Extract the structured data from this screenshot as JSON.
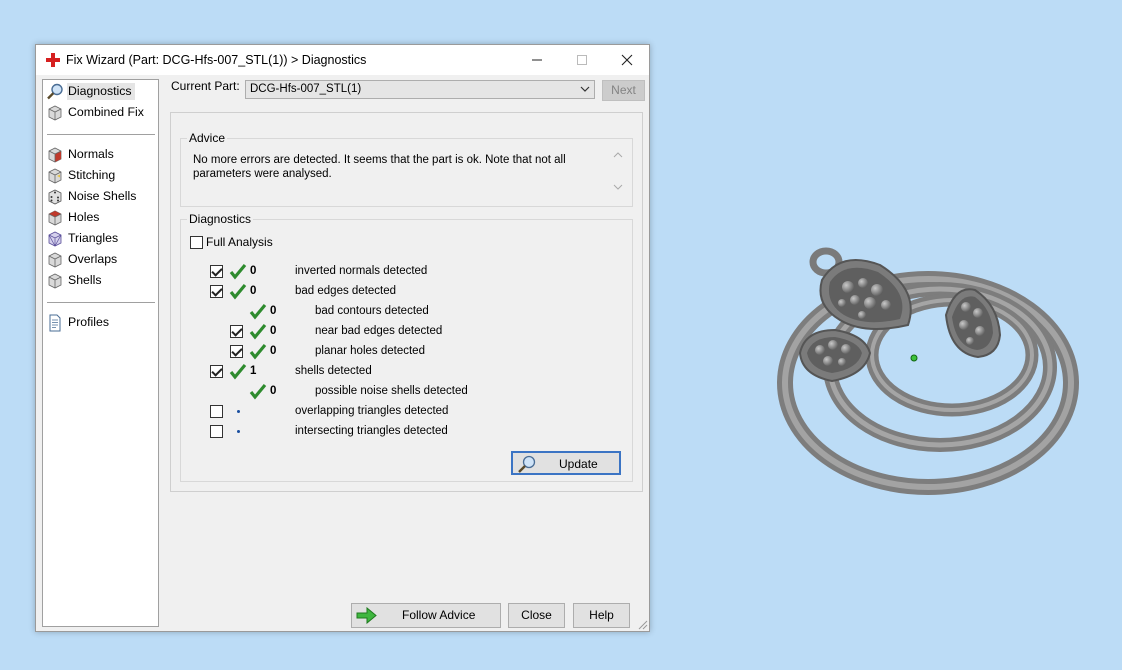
{
  "window": {
    "title": "Fix Wizard (Part: DCG-Hfs-007_STL(1)) > Diagnostics",
    "minimize_icon": "minimize-icon",
    "maximize_icon": "maximize-icon",
    "close_icon": "close-icon"
  },
  "sidebar": {
    "items": [
      {
        "label": "Diagnostics",
        "icon": "magnifier-icon",
        "selected": true
      },
      {
        "label": "Combined Fix",
        "icon": "cube-icon"
      },
      {
        "label": "Normals",
        "icon": "cube-red-face-icon"
      },
      {
        "label": "Stitching",
        "icon": "cube-stitch-icon"
      },
      {
        "label": "Noise Shells",
        "icon": "dice-icon"
      },
      {
        "label": "Holes",
        "icon": "cube-red-face-icon"
      },
      {
        "label": "Triangles",
        "icon": "cube-triangle-icon"
      },
      {
        "label": "Overlaps",
        "icon": "cube-icon"
      },
      {
        "label": "Shells",
        "icon": "cube-icon"
      },
      {
        "label": "Profiles",
        "icon": "document-icon"
      }
    ]
  },
  "current_part": {
    "label": "Current Part:",
    "value": "DCG-Hfs-007_STL(1)",
    "next_label": "Next"
  },
  "advice": {
    "title": "Advice",
    "text": "No more errors are detected. It seems that the part is ok. Note that not all parameters were analysed."
  },
  "diagnostics": {
    "title": "Diagnostics",
    "full_analysis_label": "Full Analysis",
    "rows": [
      {
        "checkbox": true,
        "checked": true,
        "status": "ok",
        "count": "0",
        "label": "inverted normals detected"
      },
      {
        "checkbox": true,
        "checked": true,
        "status": "ok",
        "count": "0",
        "label": "bad edges detected"
      },
      {
        "checkbox": false,
        "status": "ok",
        "count": "0",
        "label": "bad contours detected"
      },
      {
        "checkbox": true,
        "checked": true,
        "status": "ok",
        "count": "0",
        "label": "near bad edges detected"
      },
      {
        "checkbox": true,
        "checked": true,
        "status": "ok",
        "count": "0",
        "label": "planar holes detected"
      },
      {
        "checkbox": true,
        "checked": true,
        "status": "ok",
        "count": "1",
        "label": "shells detected"
      },
      {
        "checkbox": false,
        "status": "ok",
        "count": "0",
        "label": "possible noise shells detected"
      },
      {
        "checkbox": true,
        "checked": false,
        "status": "pending",
        "count": "",
        "label": "overlapping triangles detected"
      },
      {
        "checkbox": true,
        "checked": false,
        "status": "pending",
        "count": "",
        "label": "intersecting triangles detected"
      }
    ],
    "update_label": "Update"
  },
  "footer": {
    "follow_advice_label": "Follow Advice",
    "close_label": "Close",
    "help_label": "Help"
  },
  "colors": {
    "desktop": "#bcdcf6",
    "check_green": "#2e8b2e",
    "accent_blue": "#3b74c4",
    "model_gray": "#8a8a8a"
  }
}
